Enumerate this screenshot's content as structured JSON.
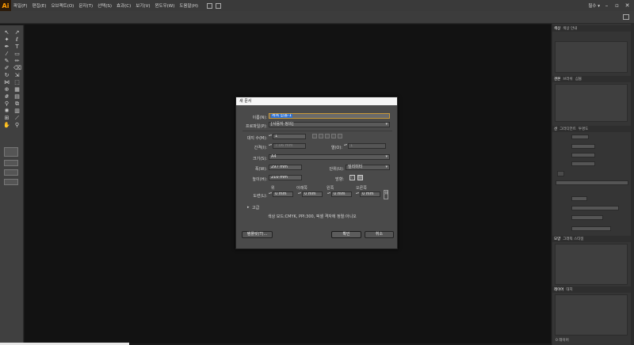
{
  "app": {
    "logo": "Ai",
    "menu": [
      "파일(F)",
      "편집(E)",
      "오브젝트(O)",
      "문자(T)",
      "선택(S)",
      "효과(C)",
      "보기(V)",
      "윈도우(W)",
      "도움말(H)"
    ],
    "workspace_label": "필수 ▾"
  },
  "right_panels": {
    "tabs1": [
      "색상",
      "색상 안내"
    ],
    "tabs2": [
      "견본",
      "브러쉬",
      "심볼"
    ],
    "tabs3": [
      "선",
      "그라디언트",
      "투명도"
    ],
    "tabs4": [
      "모양",
      "그래픽 스타일"
    ],
    "tabs5": [
      "레이어",
      "대지"
    ],
    "layer_count": "0 레이어"
  },
  "dialog": {
    "title": "새 문서",
    "name_label": "이름(N):",
    "name_value": "제목 없음-1",
    "profile_label": "프로파일(P):",
    "profile_value": "[사용자 정의]",
    "artboards_label": "대지 수(M):",
    "artboards_value": "1",
    "spacing_label": "간격(I):",
    "spacing_value": "7.06 mm",
    "columns_label": "열(O):",
    "columns_value": "1",
    "size_label": "크기(S):",
    "size_value": "A4",
    "width_label": "폭(W):",
    "width_value": "297 mm",
    "units_label": "단위(U):",
    "units_value": "밀리미터",
    "height_label": "높이(H):",
    "height_value": "210 mm",
    "orientation_label": "방향:",
    "bleed_label": "도련(L):",
    "bleed_headers": [
      "위",
      "아래쪽",
      "왼쪽",
      "오른쪽"
    ],
    "bleed_values": [
      "0 mm",
      "0 mm",
      "0 mm",
      "0 mm"
    ],
    "advanced_label": "고급",
    "info_text": "색상 모드:CMYK, PPI:300, 픽셀 격자에 정렬:아니오",
    "templates_button": "템플릿(T)...",
    "ok_button": "확인",
    "cancel_button": "취소"
  }
}
